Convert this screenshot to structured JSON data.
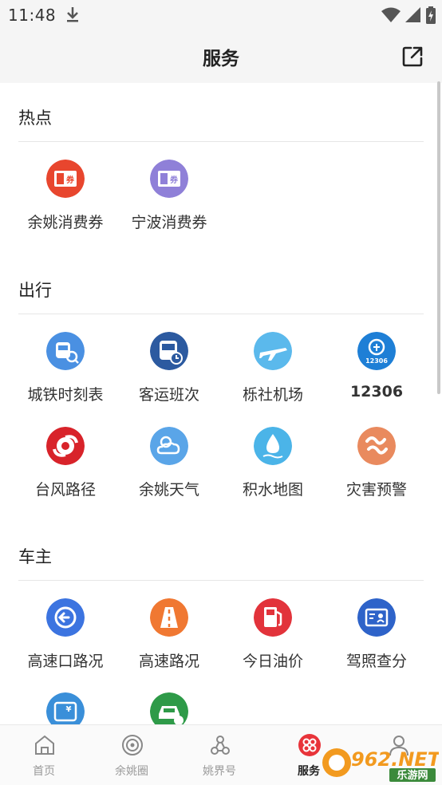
{
  "status": {
    "time": "11:48"
  },
  "header": {
    "title": "服务"
  },
  "sections": [
    {
      "title": "热点",
      "items": [
        {
          "label": "余姚消费券",
          "icon": "red-coupon-icon"
        },
        {
          "label": "宁波消费券",
          "icon": "purple-coupon-icon"
        }
      ]
    },
    {
      "title": "出行",
      "items": [
        {
          "label": "城铁时刻表",
          "icon": "metro-train-icon"
        },
        {
          "label": "客运班次",
          "icon": "bus-icon"
        },
        {
          "label": "栎社机场",
          "icon": "airplane-icon"
        },
        {
          "label": "12306",
          "icon": "railway-12306-icon",
          "badge": "12306"
        },
        {
          "label": "台风路径",
          "icon": "typhoon-icon"
        },
        {
          "label": "余姚天气",
          "icon": "weather-icon"
        },
        {
          "label": "积水地图",
          "icon": "water-drop-icon"
        },
        {
          "label": "灾害预警",
          "icon": "disaster-warning-icon"
        }
      ]
    },
    {
      "title": "车主",
      "items": [
        {
          "label": "高速口路况",
          "icon": "highway-exit-icon"
        },
        {
          "label": "高速路况",
          "icon": "highway-road-icon"
        },
        {
          "label": "今日油价",
          "icon": "fuel-pump-icon"
        },
        {
          "label": "驾照查分",
          "icon": "driver-license-icon"
        },
        {
          "label": "",
          "icon": "vehicle-tax-icon"
        },
        {
          "label": "",
          "icon": "car-inspection-icon"
        }
      ]
    }
  ],
  "tabs": [
    {
      "label": "首页",
      "icon": "home-icon"
    },
    {
      "label": "余姚圈",
      "icon": "circle-icon"
    },
    {
      "label": "姚界号",
      "icon": "nodes-icon"
    },
    {
      "label": "服务",
      "icon": "service-icon",
      "active": true
    },
    {
      "label": "",
      "icon": "profile-icon"
    }
  ],
  "watermark": {
    "text_main": "962.NET",
    "text_sub": "乐游网"
  },
  "colors": {
    "active_tab": "#e8343a",
    "background": "#ffffff",
    "bar": "#f5f5f5"
  }
}
